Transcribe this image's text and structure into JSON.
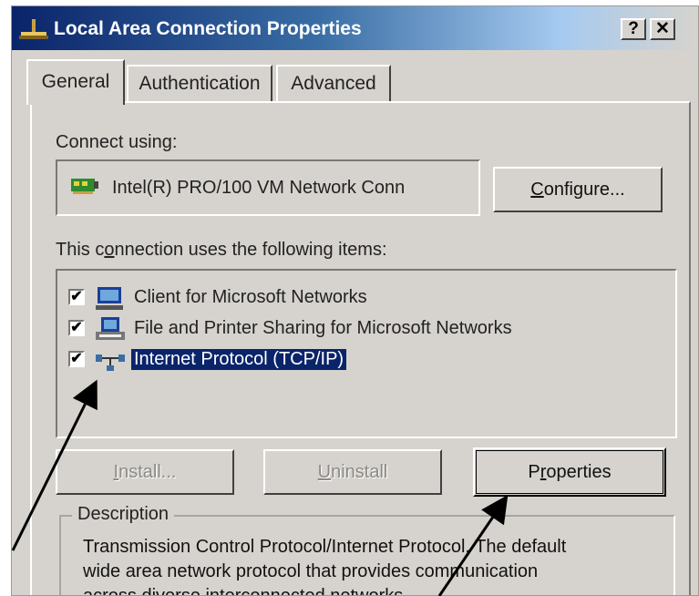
{
  "window": {
    "title": "Local Area Connection Properties",
    "help_button": "?",
    "close_button": "✕"
  },
  "tabs": [
    {
      "label": "General",
      "active": true
    },
    {
      "label": "Authentication",
      "active": false
    },
    {
      "label": "Advanced",
      "active": false
    }
  ],
  "connect_using": {
    "label": "Connect using:",
    "adapter_name": "Intel(R) PRO/100 VM Network Conn",
    "configure_button": {
      "prefix": "",
      "accel": "C",
      "rest": "onfigure..."
    }
  },
  "items_section": {
    "label_prefix": "This c",
    "label_accel": "o",
    "label_rest": "nnection uses the following items:",
    "items": [
      {
        "label": "Client for Microsoft Networks",
        "checked": true,
        "selected": false,
        "icon": "computer-icon"
      },
      {
        "label": "File and Printer Sharing for Microsoft Networks",
        "checked": true,
        "selected": false,
        "icon": "printer-icon"
      },
      {
        "label": "Internet Protocol (TCP/IP)",
        "checked": true,
        "selected": true,
        "icon": "network-protocol-icon"
      }
    ]
  },
  "buttons": {
    "install": {
      "prefix": "",
      "accel": "I",
      "rest": "nstall...",
      "enabled": true
    },
    "uninstall": {
      "prefix": "",
      "accel": "U",
      "rest": "ninstall",
      "enabled": false
    },
    "properties": {
      "prefix": "P",
      "accel": "r",
      "rest": "operties",
      "enabled": true
    }
  },
  "description": {
    "title": "Description",
    "line1": "Transmission Control Protocol/Internet Protocol. The default",
    "line2": "wide area network protocol that provides communication",
    "line3": "across diverse interconnected networks."
  },
  "colors": {
    "title_bar_start": "#0a246a",
    "dialog_background": "#d6d3ce",
    "selection_highlight": "#0a246a"
  }
}
